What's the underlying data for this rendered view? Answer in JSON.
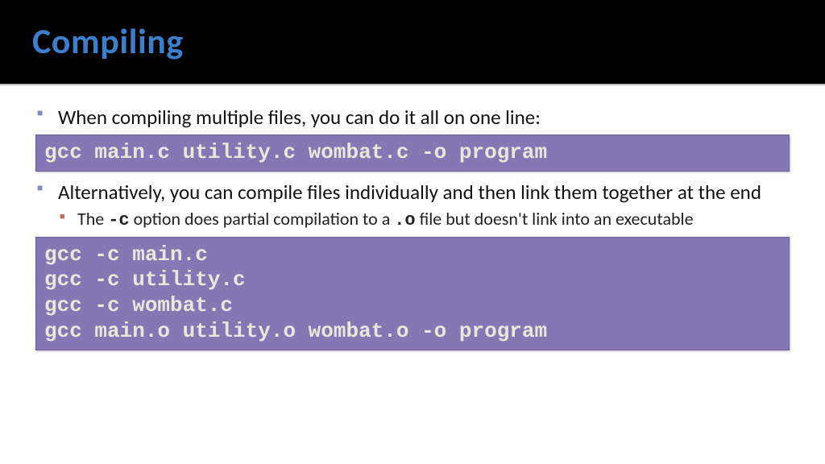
{
  "title": "Compiling",
  "bullets": {
    "b1": "When compiling multiple files, you can do it all on one line:",
    "b2": "Alternatively, you can compile files individually and then link them together at the end",
    "b2a_pre": "The ",
    "b2a_opt": "-c",
    "b2a_mid": " option does partial compilation to a ",
    "b2a_ext": ".o",
    "b2a_post": " file but doesn't link into an executable"
  },
  "code1": "gcc main.c utility.c wombat.c -o program",
  "code2": "gcc -c main.c\ngcc -c utility.c\ngcc -c wombat.c\ngcc main.o utility.o wombat.o -o program"
}
